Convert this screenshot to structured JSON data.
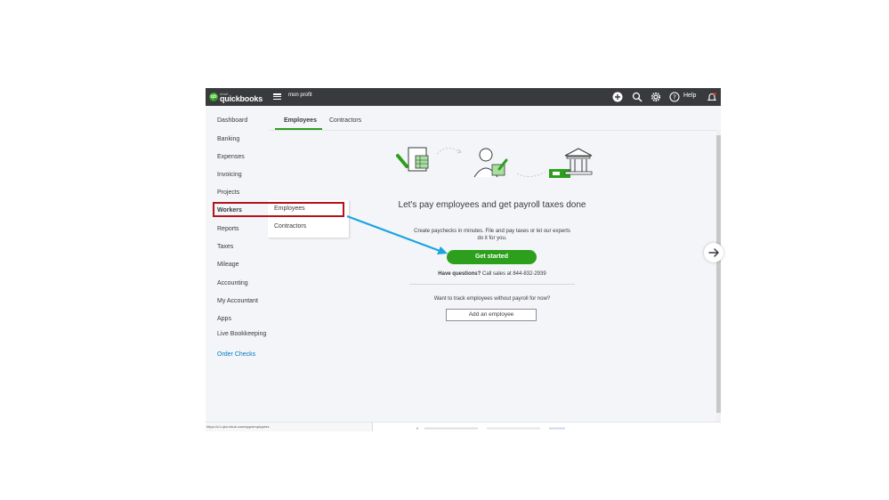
{
  "topbar": {
    "logo_small": "intuit",
    "logo_text": "quickbooks",
    "company_name": "mon profit",
    "help_label": "Help",
    "icons": [
      "plus-icon",
      "search-icon",
      "gear-icon",
      "help-icon",
      "bell-icon"
    ]
  },
  "sidebar": {
    "items": [
      {
        "label": "Dashboard"
      },
      {
        "label": "Banking"
      },
      {
        "label": "Expenses"
      },
      {
        "label": "Invoicing"
      },
      {
        "label": "Projects"
      },
      {
        "label": "Workers"
      },
      {
        "label": "Reports"
      },
      {
        "label": "Taxes"
      },
      {
        "label": "Mileage"
      },
      {
        "label": "Accounting"
      },
      {
        "label": "My Accountant"
      },
      {
        "label": "Apps"
      },
      {
        "label": "Live Bookkeeping"
      },
      {
        "label": "Order Checks"
      }
    ]
  },
  "flyout": {
    "items": [
      {
        "label": "Employees"
      },
      {
        "label": "Contractors"
      }
    ]
  },
  "tabs": [
    {
      "label": "Employees"
    },
    {
      "label": "Contractors"
    }
  ],
  "main": {
    "headline": "Let's pay employees and get payroll taxes done",
    "subtext": "Create paychecks in minutes. File and pay taxes or let our experts do it for you.",
    "get_started_label": "Get started",
    "questions_bold": "Have questions?",
    "questions_rest": " Call sales at 844-832-2939",
    "track_text": "Want to track employees without payroll for now?",
    "add_employee_label": "Add an employee"
  },
  "status_url": "https://c1.qbo.intuit.com/app/employees",
  "colors": {
    "brand_green": "#2ca01c",
    "topbar": "#393a3d",
    "annotation_red": "#b5121b",
    "annotation_blue": "#1ba5e0",
    "link_blue": "#0077c5"
  }
}
